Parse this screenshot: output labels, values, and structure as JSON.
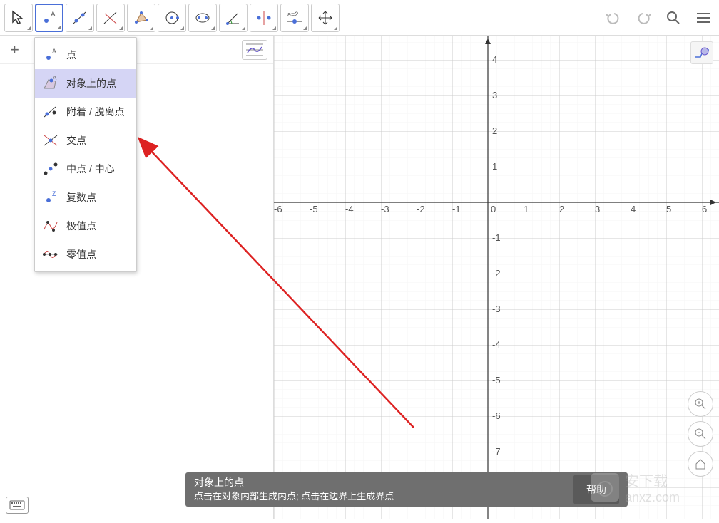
{
  "toolbar": {
    "tools": [
      "move",
      "point",
      "line",
      "perpendicular",
      "polygon",
      "circle",
      "ellipse",
      "angle",
      "reflect",
      "slider",
      "move-view"
    ],
    "slider_label": "a=2"
  },
  "dropdown": {
    "items": [
      {
        "label": "点",
        "icon": "point"
      },
      {
        "label": "对象上的点",
        "icon": "point-on-object",
        "selected": true
      },
      {
        "label": "附着 / 脱离点",
        "icon": "attach-detach"
      },
      {
        "label": "交点",
        "icon": "intersect"
      },
      {
        "label": "中点 / 中心",
        "icon": "midpoint"
      },
      {
        "label": "复数点",
        "icon": "complex"
      },
      {
        "label": "极值点",
        "icon": "extremum"
      },
      {
        "label": "零值点",
        "icon": "roots"
      }
    ]
  },
  "tooltip": {
    "title": "对象上的点",
    "desc": "点击在对象内部生成内点; 点击在边界上生成界点",
    "help": "帮助"
  },
  "axes": {
    "x": [
      "-6",
      "-5",
      "-4",
      "-3",
      "-2",
      "-1",
      "0",
      "1",
      "2",
      "3",
      "4",
      "5",
      "6"
    ],
    "y_pos": [
      "1",
      "2",
      "3",
      "4"
    ],
    "y_neg": [
      "-1",
      "-2",
      "-3",
      "-4",
      "-5",
      "-6",
      "-7"
    ]
  },
  "watermark": "anxz.com",
  "watermark_sub": "安下载"
}
